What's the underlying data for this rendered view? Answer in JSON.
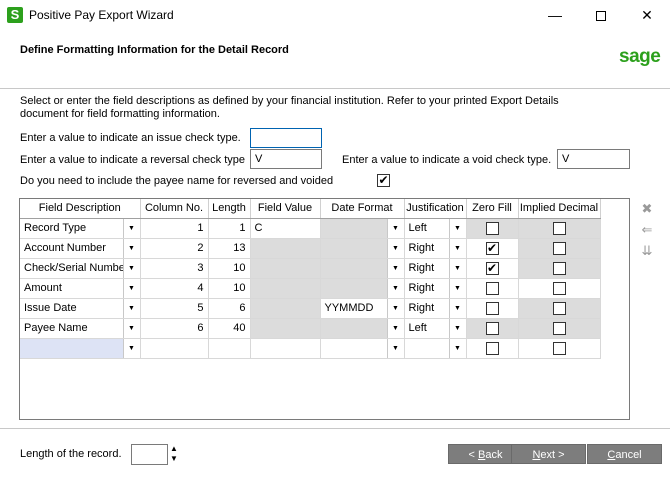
{
  "window": {
    "app_icon_letter": "S",
    "title": "Positive Pay Export Wizard",
    "minimize": "—",
    "close": "✕"
  },
  "header": {
    "title": "Define Formatting Information for the Detail Record",
    "logo": "sage"
  },
  "instructions": "Select or enter the field descriptions as defined by your financial institution.  Refer to your printed Export Details document for field formatting information.",
  "form": {
    "issue_label": "Enter a value to indicate an issue check type.",
    "issue_value": "",
    "reversal_label": "Enter a value to indicate a reversal check type",
    "reversal_value": "V",
    "void_label": "Enter a value to indicate a void check type.",
    "void_value": "V",
    "payee_label": "Do you need to include the payee name for reversed and voided",
    "payee_checked": "✔"
  },
  "grid": {
    "headers": [
      "Field Description",
      "Column No.",
      "Length",
      "Field Value",
      "Date Format",
      "Justification",
      "Zero Fill",
      "Implied Decimal"
    ],
    "dropdown_arrow": "▼",
    "check_mark": "✔",
    "rows": [
      {
        "desc": "Record Type",
        "col": "1",
        "len": "1",
        "value": "C",
        "date": "",
        "just": "Left",
        "zero": "",
        "implied": ""
      },
      {
        "desc": "Account Number",
        "col": "2",
        "len": "13",
        "value": "",
        "date": "",
        "just": "Right",
        "zero": "✔",
        "implied": ""
      },
      {
        "desc": "Check/Serial Numbe",
        "col": "3",
        "len": "10",
        "value": "",
        "date": "",
        "just": "Right",
        "zero": "✔",
        "implied": ""
      },
      {
        "desc": "Amount",
        "col": "4",
        "len": "10",
        "value": "",
        "date": "",
        "just": "Right",
        "zero": "",
        "implied": ""
      },
      {
        "desc": "Issue Date",
        "col": "5",
        "len": "6",
        "value": "",
        "date": "YYMMDD",
        "just": "Right",
        "zero": "",
        "implied": ""
      },
      {
        "desc": "Payee Name",
        "col": "6",
        "len": "40",
        "value": "",
        "date": "",
        "just": "Left",
        "zero": "",
        "implied": ""
      }
    ]
  },
  "side_icons": {
    "delete": "✖",
    "insert": "⇐",
    "move": "⇊"
  },
  "footer": {
    "length_label": "Length of the record.",
    "length_value": "",
    "spin_up": "▲",
    "spin_down": "▼",
    "back_prefix": "< ",
    "back_mnemonic": "B",
    "back_rest": "ack",
    "next_mnemonic": "N",
    "next_rest": "ext >",
    "cancel_mnemonic": "C",
    "cancel_rest": "ancel"
  }
}
